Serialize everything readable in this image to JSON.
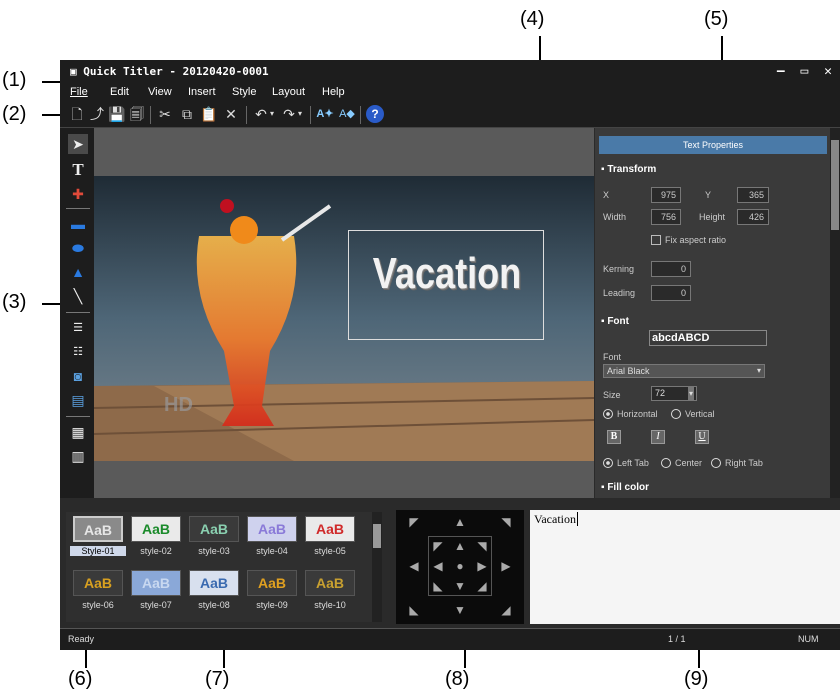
{
  "window": {
    "title": "Quick Titler - 20120420-0001",
    "controls": "– ▭ ✕"
  },
  "menu": [
    "File",
    "Edit",
    "View",
    "Insert",
    "Style",
    "Layout",
    "Help"
  ],
  "callouts": [
    "(1)",
    "(2)",
    "(3)",
    "(4)",
    "(5)",
    "(6)",
    "(7)",
    "(8)",
    "(9)"
  ],
  "canvas": {
    "title_text": "Vacation",
    "watermark": "HD"
  },
  "text_properties": {
    "header": "Text Properties",
    "transform_label": "Transform",
    "x_label": "X",
    "x_value": "975",
    "y_label": "Y",
    "y_value": "365",
    "width_label": "Width",
    "width_value": "756",
    "height_label": "Height",
    "height_value": "426",
    "fix_aspect_label": "Fix aspect ratio",
    "kerning_label": "Kerning",
    "kerning_value": "0",
    "leading_label": "Leading",
    "leading_value": "0",
    "font_section_label": "Font",
    "font_preview": "abcdABCD",
    "font_label": "Font",
    "font_value": "Arial Black",
    "size_label": "Size",
    "size_value": "72",
    "horizontal_label": "Horizontal",
    "vertical_label": "Vertical",
    "bold_label": "B",
    "italic_label": "I",
    "underline_label": "U",
    "left_tab_label": "Left Tab",
    "center_label": "Center",
    "right_tab_label": "Right Tab",
    "fill_color_label": "Fill color"
  },
  "styles": [
    {
      "label": "Style-01",
      "text": "AaB",
      "color": "#e6e6e6",
      "bg": "#8a8a8a"
    },
    {
      "label": "style-02",
      "text": "AaB",
      "color": "#1a8a2a",
      "bg": "#eaeaea"
    },
    {
      "label": "style-03",
      "text": "AaB",
      "color": "#8ad0b0",
      "bg": "#3a3a3a"
    },
    {
      "label": "style-04",
      "text": "AaB",
      "color": "#8a7ad8",
      "bg": "#cfd2ee"
    },
    {
      "label": "style-05",
      "text": "AaB",
      "color": "#d02a2a",
      "bg": "#eaeaea"
    },
    {
      "label": "style-06",
      "text": "AaB",
      "color": "#d8a020",
      "bg": "#3a3a3a"
    },
    {
      "label": "style-07",
      "text": "AaB",
      "color": "#c8d8f0",
      "bg": "#8aa8d8"
    },
    {
      "label": "style-08",
      "text": "AaB",
      "color": "#3a6ab0",
      "bg": "#d8e0ee"
    },
    {
      "label": "style-09",
      "text": "AaB",
      "color": "#e0a020",
      "bg": "#3a3a3a"
    },
    {
      "label": "style-10",
      "text": "AaB",
      "color": "#c8a030",
      "bg": "#3a3a3a"
    }
  ],
  "text_edit": {
    "content": "Vacation"
  },
  "status": {
    "ready": "Ready",
    "page": "1 / 1",
    "num": "NUM"
  }
}
